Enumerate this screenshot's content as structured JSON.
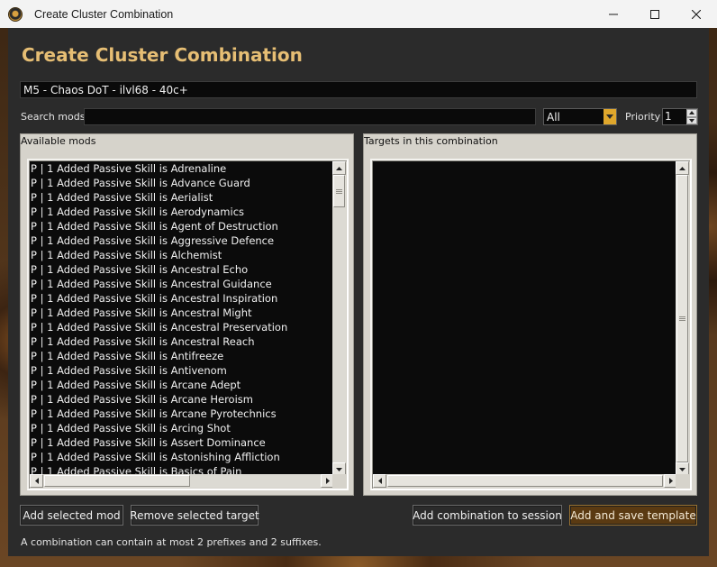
{
  "window": {
    "title": "Create Cluster Combination",
    "icon": "app-logo-icon"
  },
  "dialog": {
    "heading": "Create Cluster Combination",
    "combination_name": "M5 - Chaos DoT - ilvl68 - 40c+",
    "search": {
      "label": "Search mods",
      "value": ""
    },
    "filter": {
      "value": "All"
    },
    "priority": {
      "label": "Priority",
      "value": "1"
    },
    "available": {
      "title": "Available mods",
      "items": [
        "P  |  1 Added Passive Skill is Adrenaline",
        "P  |  1 Added Passive Skill is Advance Guard",
        "P  |  1 Added Passive Skill is Aerialist",
        "P  |  1 Added Passive Skill is Aerodynamics",
        "P  |  1 Added Passive Skill is Agent of Destruction",
        "P  |  1 Added Passive Skill is Aggressive Defence",
        "P  |  1 Added Passive Skill is Alchemist",
        "P  |  1 Added Passive Skill is Ancestral Echo",
        "P  |  1 Added Passive Skill is Ancestral Guidance",
        "P  |  1 Added Passive Skill is Ancestral Inspiration",
        "P  |  1 Added Passive Skill is Ancestral Might",
        "P  |  1 Added Passive Skill is Ancestral Preservation",
        "P  |  1 Added Passive Skill is Ancestral Reach",
        "P  |  1 Added Passive Skill is Antifreeze",
        "P  |  1 Added Passive Skill is Antivenom",
        "P  |  1 Added Passive Skill is Arcane Adept",
        "P  |  1 Added Passive Skill is Arcane Heroism",
        "P  |  1 Added Passive Skill is Arcane Pyrotechnics",
        "P  |  1 Added Passive Skill is Arcing Shot",
        "P  |  1 Added Passive Skill is Assert Dominance",
        "P  |  1 Added Passive Skill is Astonishing Affliction",
        "P  |  1 Added Passive Skill is Basics of Pain"
      ]
    },
    "targets": {
      "title": "Targets in this combination",
      "items": []
    },
    "buttons": {
      "add_mod": "Add selected mod",
      "remove_target": "Remove selected target",
      "add_to_session": "Add combination to session",
      "save_template": "Add and save template"
    },
    "note": "A combination can contain at most 2 prefixes and 2 suffixes."
  },
  "colors": {
    "heading": "#e6be74",
    "dialog_bg": "#2b2b2b",
    "accent": "#e0a72c",
    "primary_button": "#5a3a12"
  }
}
